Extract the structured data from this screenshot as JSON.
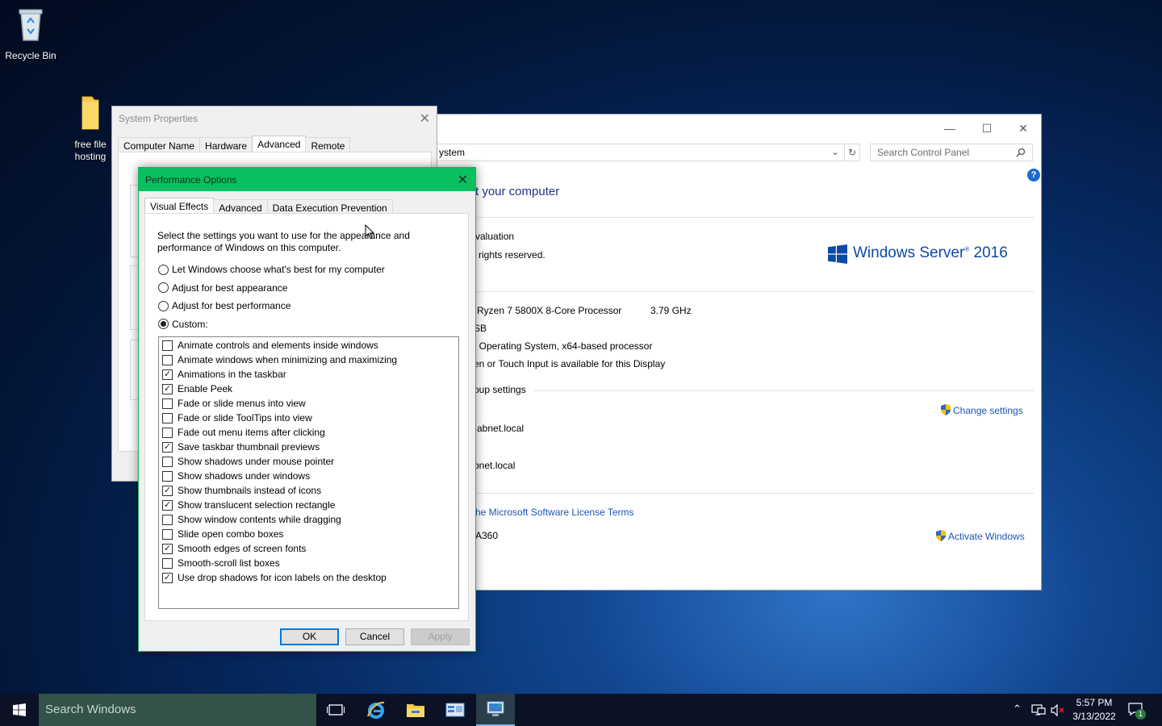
{
  "desktop": {
    "icons": [
      {
        "label": "Recycle Bin"
      },
      {
        "label": "free file hosting"
      }
    ]
  },
  "control_panel": {
    "address": "ystem",
    "search_placeholder": "Search Control Panel",
    "help_symbol": "?",
    "heading": "t your computer",
    "edition_line": "valuation",
    "rights_line": "rights reserved.",
    "os_brand": "Windows Server",
    "os_version": "2016",
    "processor": "Ryzen 7 5800X 8-Core Processor",
    "processor_speed": "3.79 GHz",
    "ram": "SB",
    "system_type": ": Operating System, x64-based processor",
    "pen_touch": "en or Touch Input is available for this Display",
    "group_label": "oup settings",
    "change_settings": "Change settings",
    "domain_line1": "abnet.local",
    "domain_line2": "onet.local",
    "license_link": "he Microsoft Software License Terms",
    "product_id": "A360",
    "activate": "Activate Windows"
  },
  "system_properties": {
    "title": "System Properties",
    "tabs": [
      "Computer Name",
      "Hardware",
      "Advanced",
      "Remote"
    ],
    "active_tab": "Advanced"
  },
  "performance_options": {
    "title": "Performance Options",
    "tabs": [
      "Visual Effects",
      "Advanced",
      "Data Execution Prevention"
    ],
    "active_tab": "Visual Effects",
    "description": "Select the settings you want to use for the appearance and performance of Windows on this computer.",
    "radio_options": [
      {
        "label": "Let Windows choose what's best for my computer",
        "selected": false
      },
      {
        "label": "Adjust for best appearance",
        "selected": false
      },
      {
        "label": "Adjust for best performance",
        "selected": false
      },
      {
        "label": "Custom:",
        "selected": true
      }
    ],
    "checkboxes": [
      {
        "label": "Animate controls and elements inside windows",
        "checked": false
      },
      {
        "label": "Animate windows when minimizing and maximizing",
        "checked": false
      },
      {
        "label": "Animations in the taskbar",
        "checked": true
      },
      {
        "label": "Enable Peek",
        "checked": true
      },
      {
        "label": "Fade or slide menus into view",
        "checked": false
      },
      {
        "label": "Fade or slide ToolTips into view",
        "checked": false
      },
      {
        "label": "Fade out menu items after clicking",
        "checked": false
      },
      {
        "label": "Save taskbar thumbnail previews",
        "checked": true
      },
      {
        "label": "Show shadows under mouse pointer",
        "checked": false
      },
      {
        "label": "Show shadows under windows",
        "checked": false
      },
      {
        "label": "Show thumbnails instead of icons",
        "checked": true
      },
      {
        "label": "Show translucent selection rectangle",
        "checked": true
      },
      {
        "label": "Show window contents while dragging",
        "checked": false
      },
      {
        "label": "Slide open combo boxes",
        "checked": false
      },
      {
        "label": "Smooth edges of screen fonts",
        "checked": true
      },
      {
        "label": "Smooth-scroll list boxes",
        "checked": false
      },
      {
        "label": "Use drop shadows for icon labels on the desktop",
        "checked": true
      }
    ],
    "buttons": {
      "ok": "OK",
      "cancel": "Cancel",
      "apply": "Apply"
    }
  },
  "taskbar": {
    "search_placeholder": "Search Windows",
    "time": "5:57 PM",
    "date": "3/13/2022",
    "notification_count": "1"
  },
  "colors": {
    "accent_green": "#09bf5f",
    "link_blue": "#1a55b3",
    "heading_blue": "#1e3287"
  }
}
